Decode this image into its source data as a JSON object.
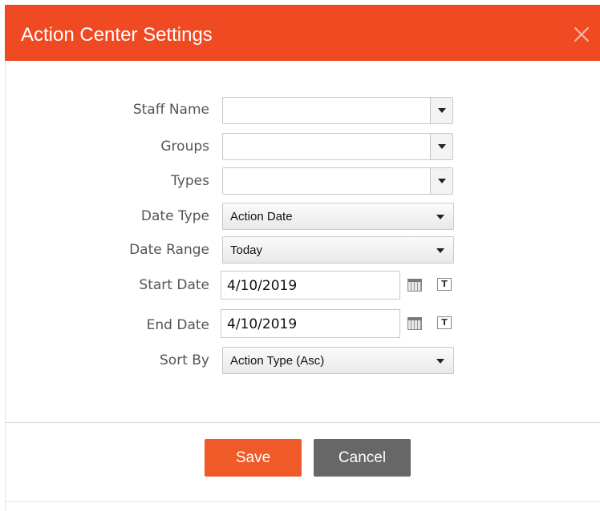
{
  "dialog": {
    "title": "Action Center Settings",
    "close_icon": "close-icon"
  },
  "form": {
    "staff_name": {
      "label": "Staff Name",
      "value": ""
    },
    "groups": {
      "label": "Groups",
      "value": ""
    },
    "types": {
      "label": "Types",
      "value": ""
    },
    "date_type": {
      "label": "Date Type",
      "value": "Action Date"
    },
    "date_range": {
      "label": "Date Range",
      "value": "Today"
    },
    "start_date": {
      "label": "Start Date",
      "value": "4/10/2019",
      "calendar_icon": "calendar-icon",
      "today_icon": "today-icon",
      "today_glyph": "T"
    },
    "end_date": {
      "label": "End Date",
      "value": "4/10/2019",
      "calendar_icon": "calendar-icon",
      "today_icon": "today-icon",
      "today_glyph": "T"
    },
    "sort_by": {
      "label": "Sort By",
      "value": "Action Type (Asc)"
    }
  },
  "footer": {
    "save_label": "Save",
    "cancel_label": "Cancel"
  },
  "colors": {
    "header": "#f04a23",
    "save": "#f05a28",
    "cancel": "#676767"
  }
}
